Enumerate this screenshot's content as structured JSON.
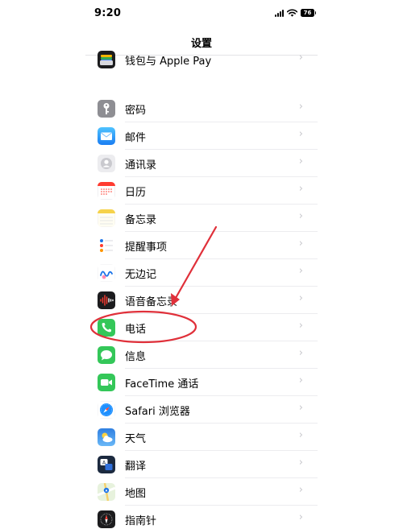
{
  "status": {
    "time": "9:20",
    "battery": "76"
  },
  "nav": {
    "title": "设置"
  },
  "group1": [
    {
      "label": "钱包与 Apple Pay",
      "icon": "wallet-icon"
    }
  ],
  "group2": [
    {
      "label": "密码",
      "icon": "key-icon"
    },
    {
      "label": "邮件",
      "icon": "mail-icon"
    },
    {
      "label": "通讯录",
      "icon": "contacts-icon"
    },
    {
      "label": "日历",
      "icon": "calendar-icon"
    },
    {
      "label": "备忘录",
      "icon": "notes-icon"
    },
    {
      "label": "提醒事项",
      "icon": "reminders-icon"
    },
    {
      "label": "无边记",
      "icon": "freeform-icon"
    },
    {
      "label": "语音备忘录",
      "icon": "voice-memos-icon"
    },
    {
      "label": "电话",
      "icon": "phone-icon"
    },
    {
      "label": "信息",
      "icon": "messages-icon"
    },
    {
      "label": "FaceTime 通话",
      "icon": "facetime-icon"
    },
    {
      "label": "Safari 浏览器",
      "icon": "safari-icon"
    },
    {
      "label": "天气",
      "icon": "weather-icon"
    },
    {
      "label": "翻译",
      "icon": "translate-icon"
    },
    {
      "label": "地图",
      "icon": "maps-icon"
    },
    {
      "label": "指南针",
      "icon": "compass-icon"
    }
  ],
  "annotation": {
    "color": "#e0303a",
    "highlighted_item": "电话"
  }
}
